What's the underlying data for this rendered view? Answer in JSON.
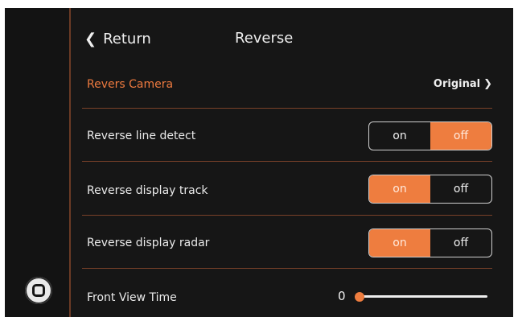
{
  "header": {
    "back_label": "Return",
    "title": "Reverse"
  },
  "rows": {
    "camera": {
      "label": "Revers Camera",
      "value": "Original"
    },
    "line_detect": {
      "label": "Reverse line detect",
      "on_label": "on",
      "off_label": "off",
      "selected": "off"
    },
    "display_track": {
      "label": "Reverse display track",
      "on_label": "on",
      "off_label": "off",
      "selected": "on"
    },
    "display_radar": {
      "label": "Reverse display radar",
      "on_label": "on",
      "off_label": "off",
      "selected": "on"
    },
    "front_view_time": {
      "label": "Front View Time",
      "value": "0",
      "level": 0
    }
  },
  "colors": {
    "accent": "#ee7d3f",
    "background": "#161616",
    "divider": "#7a4129",
    "text": "#eaeaea"
  },
  "icons": {
    "back": "chevron-left-icon",
    "camera_arrow": "chevron-right-icon",
    "home": "home-square-icon"
  }
}
